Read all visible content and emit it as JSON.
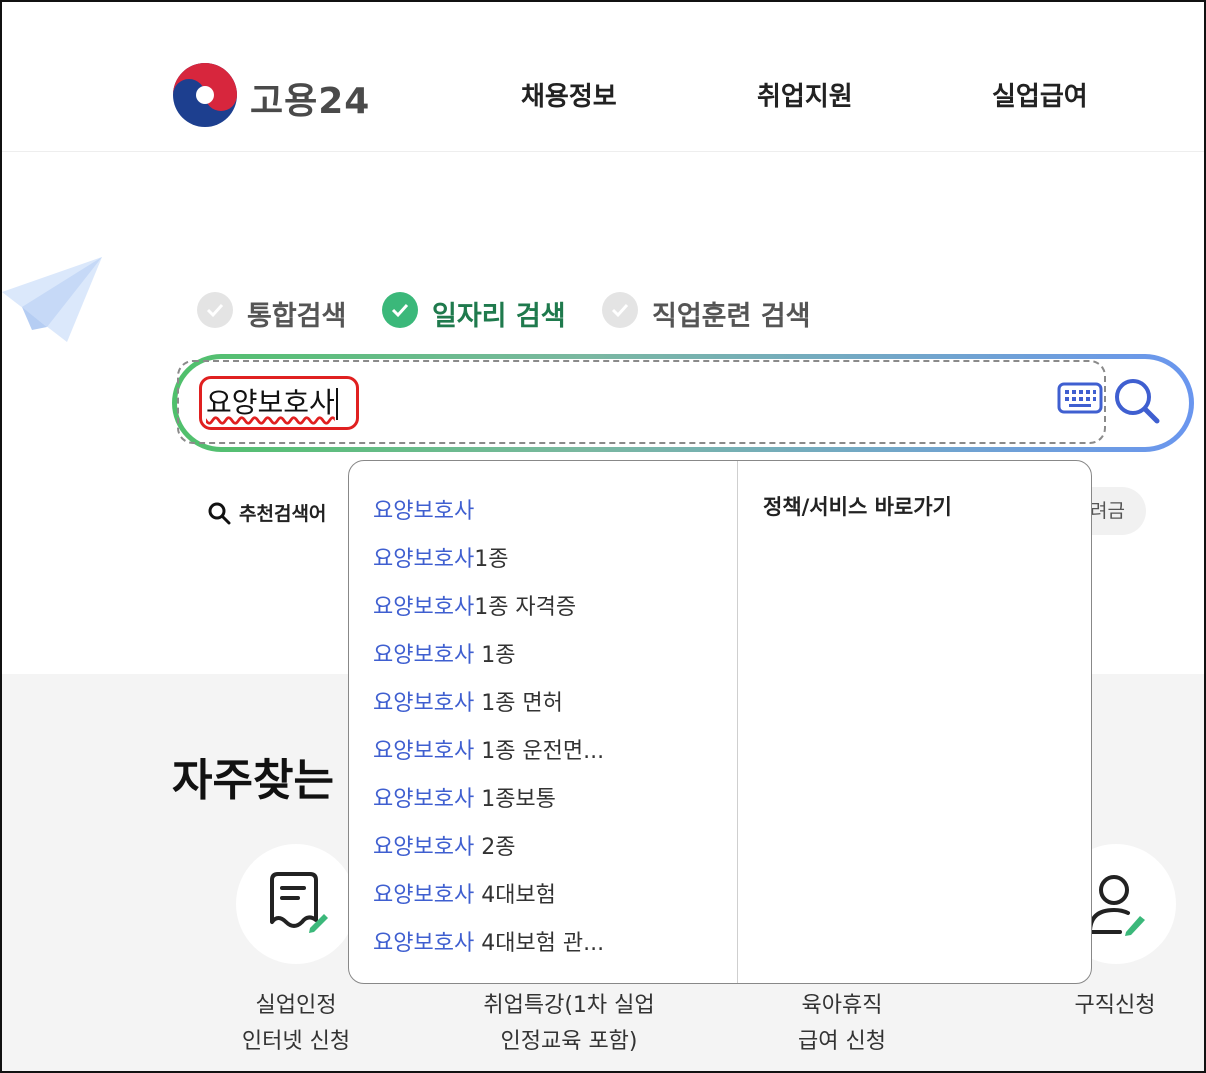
{
  "header": {
    "logo_text": "고용24",
    "nav": [
      "채용정보",
      "취업지원",
      "실업급여"
    ]
  },
  "search": {
    "tabs": [
      {
        "label": "통합검색",
        "active": false
      },
      {
        "label": "일자리 검색",
        "active": true
      },
      {
        "label": "직업훈련 검색",
        "active": false
      }
    ],
    "query": "요양보호사",
    "recommended_label": "추천검색어",
    "chip_partial": "려금"
  },
  "autocomplete": {
    "items": [
      {
        "match": "요양보호사",
        "rest": ""
      },
      {
        "match": "요양보호사",
        "rest": "1종"
      },
      {
        "match": "요양보호사",
        "rest": "1종 자격증"
      },
      {
        "match": "요양보호사",
        "rest": " 1종"
      },
      {
        "match": "요양보호사",
        "rest": " 1종 면허"
      },
      {
        "match": "요양보호사",
        "rest": " 1종 운전면..."
      },
      {
        "match": "요양보호사",
        "rest": " 1종보통"
      },
      {
        "match": "요양보호사",
        "rest": " 2종"
      },
      {
        "match": "요양보호사",
        "rest": " 4대보험"
      },
      {
        "match": "요양보호사",
        "rest": " 4대보험 관..."
      }
    ],
    "right_title": "정책/서비스 바로가기"
  },
  "faq": {
    "title": "자주찾는 서",
    "services": [
      {
        "line1": "실업인정",
        "line2": "인터넷 신청"
      },
      {
        "line1": "취업특강(1차 실업",
        "line2": "인정교육 포함)"
      },
      {
        "line1": "육아휴직",
        "line2": "급여 신청"
      },
      {
        "line1": "구직신청",
        "line2": ""
      }
    ]
  },
  "colors": {
    "accent_green": "#3bb87a",
    "accent_blue": "#6a96ef",
    "highlight": "#3f5fd0",
    "error_red": "#e02020"
  }
}
